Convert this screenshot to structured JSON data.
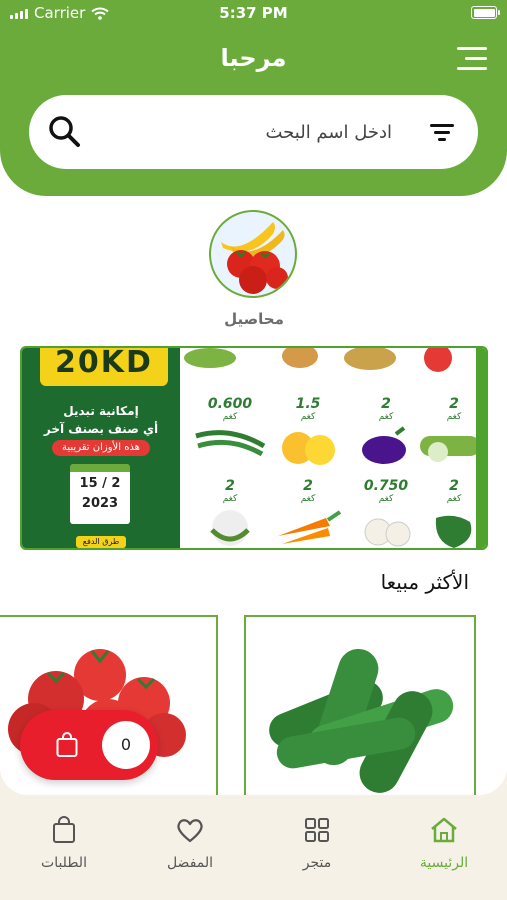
{
  "status_bar": {
    "carrier": "Carrier",
    "time": "5:37 PM"
  },
  "header": {
    "title": "مرحبا"
  },
  "search": {
    "placeholder": "ادخل اسم البحث"
  },
  "categories": [
    {
      "label": "محاصيل"
    }
  ],
  "banner": {
    "price_badge": "20KD",
    "line1": "إمكانية تبديل",
    "line2": "أي صنف بصنف آخر",
    "tag": "هذه الأوزان تقريبية",
    "date": "15 / 2",
    "year": "2023",
    "footer": "طرق الدفع",
    "produce": [
      {
        "qty": "0.600",
        "unit": "كغم",
        "icon": "green-beans"
      },
      {
        "qty": "1.5",
        "unit": "كغم",
        "icon": "lemons"
      },
      {
        "qty": "2",
        "unit": "كغم",
        "icon": "eggplant"
      },
      {
        "qty": "2",
        "unit": "كغم",
        "icon": "zucchini"
      },
      {
        "qty": "2",
        "unit": "كغم",
        "icon": "cauliflower"
      },
      {
        "qty": "2",
        "unit": "كغم",
        "icon": "carrots"
      },
      {
        "qty": "0.750",
        "unit": "كغم",
        "icon": "garlic"
      },
      {
        "qty": "2",
        "unit": "كغم",
        "icon": "green-pepper"
      }
    ]
  },
  "best_sellers": {
    "title": "الأكثر مبيعا"
  },
  "cart": {
    "count": "0"
  },
  "tabs": [
    {
      "label": "الرئيسية",
      "icon": "home-icon",
      "active": true
    },
    {
      "label": "متجر",
      "icon": "grid-icon",
      "active": false
    },
    {
      "label": "المفضل",
      "icon": "heart-icon",
      "active": false
    },
    {
      "label": "الطلبات",
      "icon": "bag-icon",
      "active": false
    }
  ],
  "colors": {
    "primary": "#6aab3c",
    "cart": "#e91e2c",
    "background": "#f6f1e7"
  }
}
